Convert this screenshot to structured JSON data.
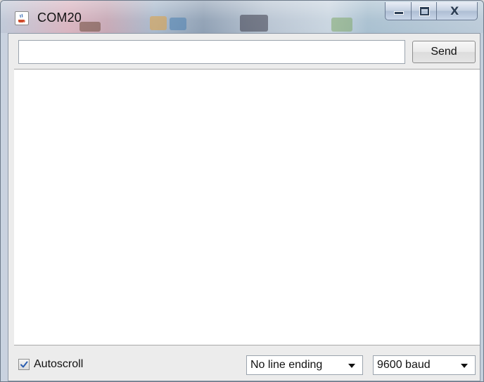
{
  "window": {
    "title": "COM20",
    "app_icon": "java-cup-icon"
  },
  "caption_buttons": {
    "minimize_icon": "minimize-icon",
    "maximize_icon": "maximize-icon",
    "close_icon": "close-icon",
    "close_glyph": "X"
  },
  "send_row": {
    "input_value": "",
    "send_label": "Send"
  },
  "output": {
    "text": ""
  },
  "bottom_bar": {
    "autoscroll_label": "Autoscroll",
    "autoscroll_checked": true,
    "line_ending_selected": "No line ending",
    "baud_selected": "9600 baud"
  },
  "colors": {
    "title_text": "#111111",
    "caption_glyph": "#2c3e55",
    "client_bg": "#ececec",
    "check_mark": "#2a5db0"
  }
}
